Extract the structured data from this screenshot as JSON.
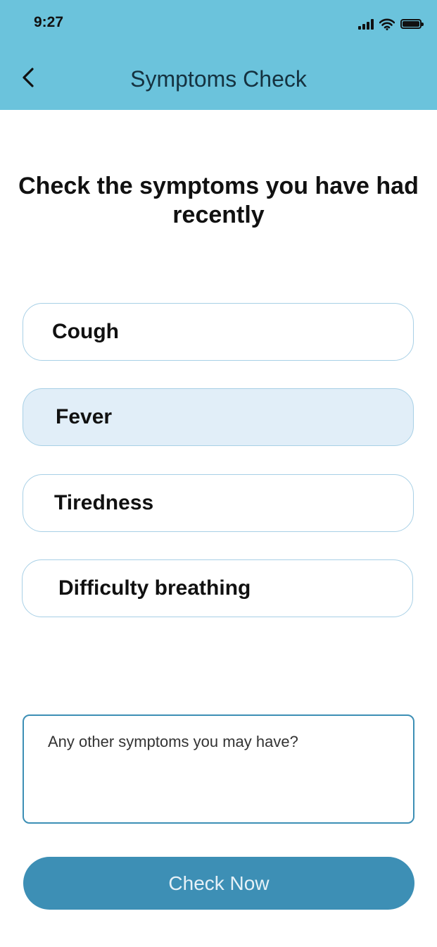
{
  "status_bar": {
    "time": "9:27"
  },
  "header": {
    "title": "Symptoms Check"
  },
  "question": "Check the symptoms you have had recently",
  "symptoms": [
    {
      "label": "Cough",
      "selected": false
    },
    {
      "label": "Fever",
      "selected": true
    },
    {
      "label": "Tiredness",
      "selected": false
    },
    {
      "label": "Difficulty breathing",
      "selected": false
    }
  ],
  "other_symptoms": {
    "placeholder": "Any other symptoms you may have?",
    "value": ""
  },
  "check_button": {
    "label": "Check Now"
  },
  "colors": {
    "header_bg": "#6bc3dc",
    "selected_bg": "#e1eef8",
    "option_border": "#a8d0e6",
    "accent": "#3d8fb5"
  }
}
